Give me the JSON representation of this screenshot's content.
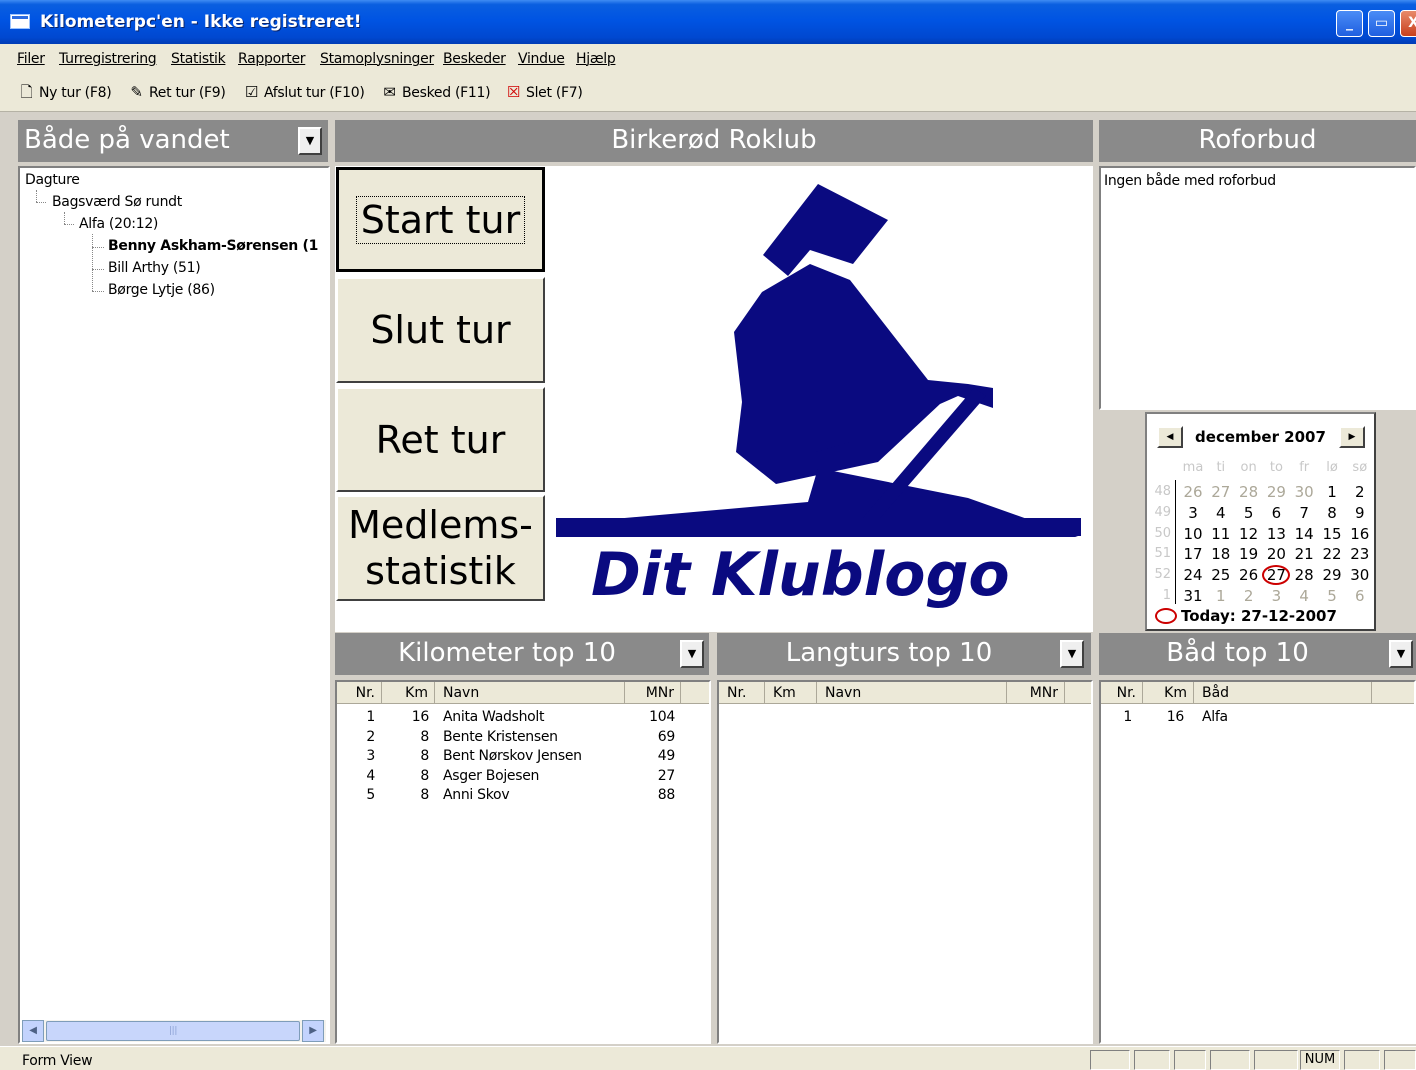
{
  "window": {
    "title": "Kilometerpc'en - Ikke registreret!",
    "controls": {
      "minimize": "_",
      "restore": "▭",
      "close": "X"
    }
  },
  "menu": [
    "Filer",
    "Turregistrering",
    "Statistik",
    "Rapporter",
    "Stamoplysninger",
    "Beskeder",
    "Vindue",
    "Hjælp"
  ],
  "toolbar": [
    {
      "label": "Ny tur (F8)",
      "icon": "new-document-icon"
    },
    {
      "label": "Ret tur (F9)",
      "icon": "edit-document-icon"
    },
    {
      "label": "Afslut tur (F10)",
      "icon": "checked-document-icon"
    },
    {
      "label": "Besked (F11)",
      "icon": "message-icon"
    },
    {
      "label": "Slet (F7)",
      "icon": "delete-document-icon"
    }
  ],
  "left_panel": {
    "title": "Både på vandet",
    "tree": {
      "root": "Dagture",
      "trip": "Bagsværd Sø rundt",
      "boat": "Alfa (20:12)",
      "crew": [
        "Benny Askham-Sørensen (1",
        "Bill Arthy (51)",
        "Børge Lytje (86)"
      ]
    },
    "scroll_thumb": "|||"
  },
  "center": {
    "title": "Birkerød Roklub",
    "buttons": {
      "start": "Start tur",
      "end": "Slut tur",
      "edit": "Ret tur",
      "stats_line1": "Medlems-",
      "stats_line2": "statistik"
    },
    "logo_text": "Dit Klublogo",
    "logo_color": "#0a0a80"
  },
  "right_panel": {
    "title": "Roforbud",
    "message": "Ingen både med roforbud"
  },
  "calendar": {
    "month_label": "december 2007",
    "weekday_headers": [
      "ma",
      "ti",
      "on",
      "to",
      "fr",
      "lø",
      "sø"
    ],
    "weeks": [
      {
        "wk": "48",
        "days": [
          "26",
          "27",
          "28",
          "29",
          "30",
          "1",
          "2"
        ],
        "grey": [
          true,
          true,
          true,
          true,
          true,
          false,
          false
        ]
      },
      {
        "wk": "49",
        "days": [
          "3",
          "4",
          "5",
          "6",
          "7",
          "8",
          "9"
        ],
        "grey": [
          false,
          false,
          false,
          false,
          false,
          false,
          false
        ]
      },
      {
        "wk": "50",
        "days": [
          "10",
          "11",
          "12",
          "13",
          "14",
          "15",
          "16"
        ],
        "grey": [
          false,
          false,
          false,
          false,
          false,
          false,
          false
        ]
      },
      {
        "wk": "51",
        "days": [
          "17",
          "18",
          "19",
          "20",
          "21",
          "22",
          "23"
        ],
        "grey": [
          false,
          false,
          false,
          false,
          false,
          false,
          false
        ]
      },
      {
        "wk": "52",
        "days": [
          "24",
          "25",
          "26",
          "27",
          "28",
          "29",
          "30"
        ],
        "grey": [
          false,
          false,
          false,
          false,
          false,
          false,
          false
        ]
      },
      {
        "wk": "1",
        "days": [
          "31",
          "1",
          "2",
          "3",
          "4",
          "5",
          "6"
        ],
        "grey": [
          false,
          true,
          true,
          true,
          true,
          true,
          true
        ]
      }
    ],
    "selected_day": "27",
    "today_label": "Today: 27-12-2007",
    "highlight_color": "#cc0000"
  },
  "km_top": {
    "title": "Kilometer top 10",
    "columns": [
      "Nr.",
      "Km",
      "Navn",
      "MNr"
    ],
    "rows": [
      [
        "1",
        "16",
        "Anita Wadsholt",
        "104"
      ],
      [
        "2",
        "8",
        "Bente Kristensen",
        "69"
      ],
      [
        "3",
        "8",
        "Bent Nørskov Jensen",
        "49"
      ],
      [
        "4",
        "8",
        "Asger Bojesen",
        "27"
      ],
      [
        "5",
        "8",
        "Anni Skov",
        "88"
      ]
    ]
  },
  "long_top": {
    "title": "Langturs top 10",
    "columns": [
      "Nr.",
      "Km",
      "Navn",
      "MNr"
    ],
    "rows": []
  },
  "boat_top": {
    "title": "Båd top 10",
    "columns": [
      "Nr.",
      "Km",
      "Båd"
    ],
    "rows": [
      [
        "1",
        "16",
        "Alfa"
      ]
    ]
  },
  "status": {
    "left": "Form View",
    "num": "NUM"
  },
  "dropdown_glyph": "▼"
}
